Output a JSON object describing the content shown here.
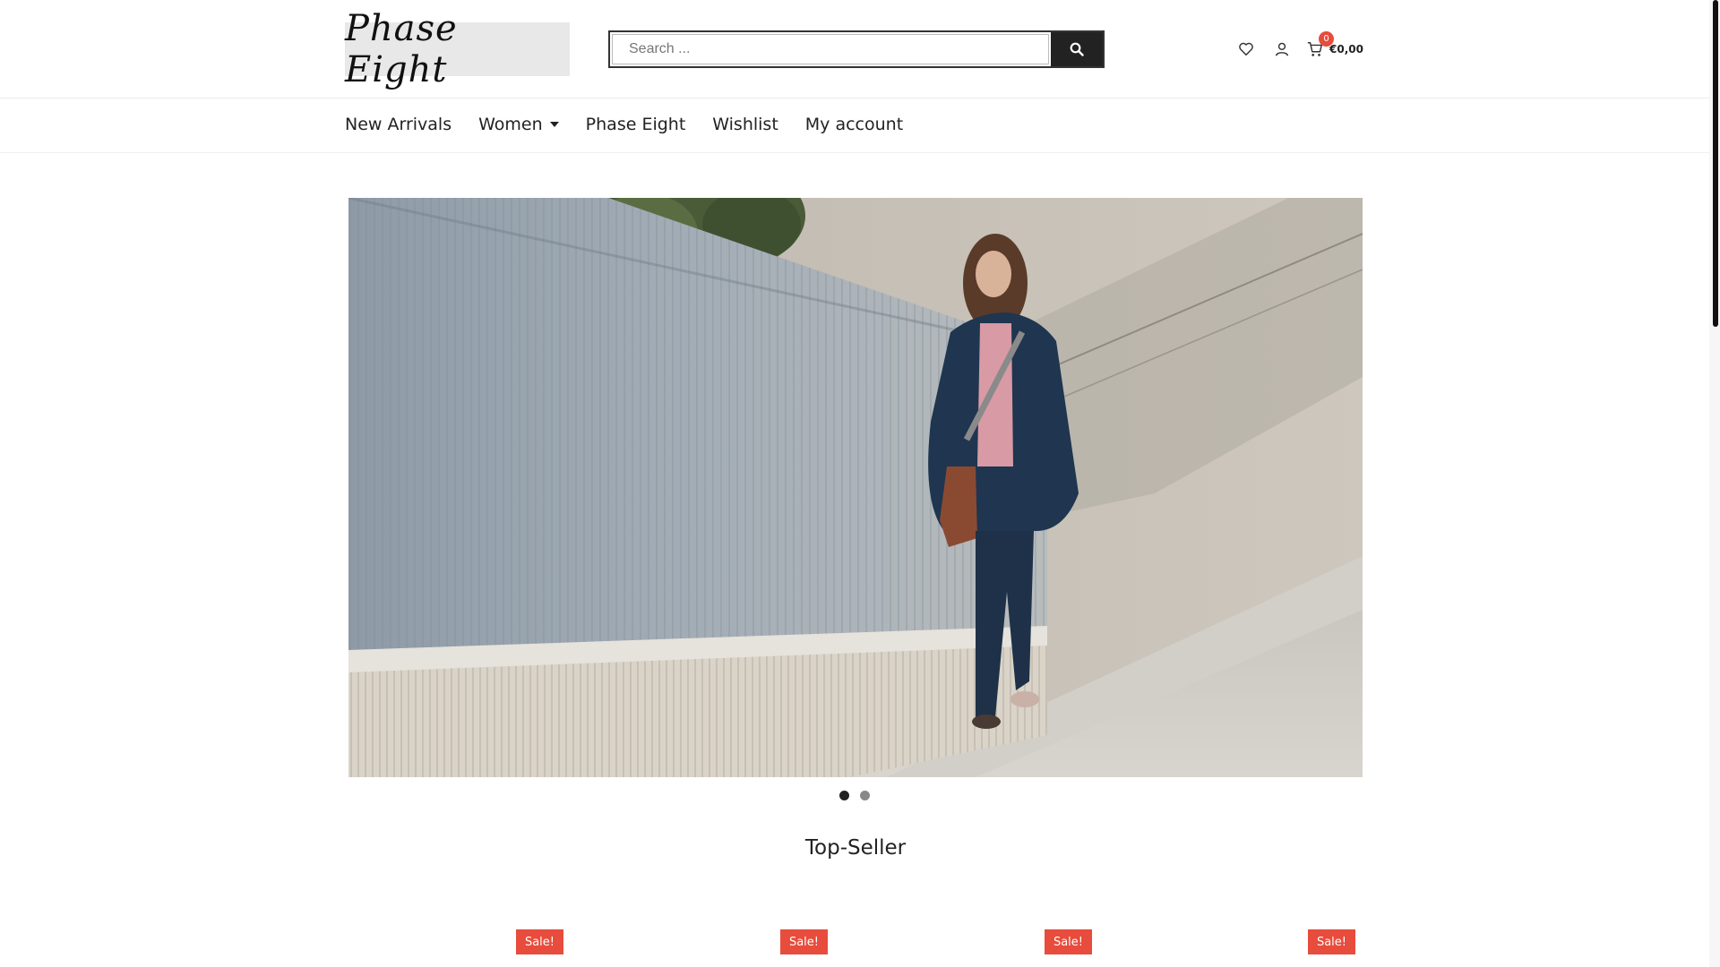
{
  "header": {
    "logo_text": "Phase Eight",
    "search": {
      "placeholder": "Search ..."
    },
    "cart": {
      "count": "0",
      "total": "€0,00"
    }
  },
  "nav": {
    "items": [
      {
        "label": "New Arrivals"
      },
      {
        "label": "Women",
        "has_dropdown": true
      },
      {
        "label": "Phase Eight"
      },
      {
        "label": "Wishlist"
      },
      {
        "label": "My account"
      }
    ]
  },
  "hero": {
    "slides": 2,
    "active_slide": 1
  },
  "section": {
    "title": "Top-Seller"
  },
  "products": [
    {
      "badge": "Sale!"
    },
    {
      "badge": "Sale!"
    },
    {
      "badge": "Sale!"
    },
    {
      "badge": "Sale!"
    }
  ],
  "colors": {
    "accent": "#e74c3c",
    "dark": "#222222"
  }
}
